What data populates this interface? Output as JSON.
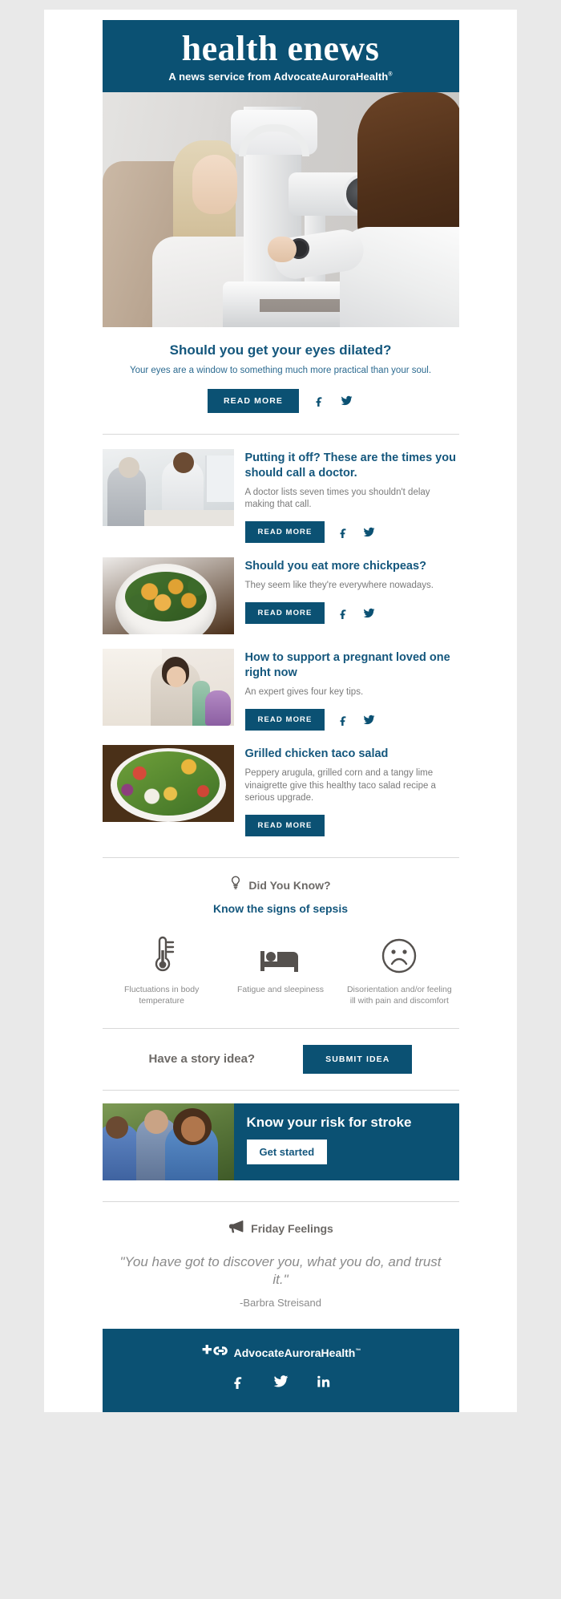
{
  "masthead": {
    "title": "health enews",
    "tagline_prefix": "A news service from ",
    "brand": "AdvocateAuroraHealth",
    "tm": "®"
  },
  "hero": {
    "image_alt": "eye-exam-photo",
    "title": "Should you get your eyes dilated?",
    "subtitle": "Your eyes are a window to something much more practical than your soul.",
    "read_more": "READ MORE",
    "facebook_icon": "facebook-icon",
    "twitter_icon": "twitter-icon"
  },
  "articles": [
    {
      "title": "Putting it off? These are the times you should call a doctor.",
      "desc": "A doctor lists seven times you shouldn't delay making that call.",
      "read_more": "READ MORE",
      "thumb": "doctor-and-patient-photo",
      "has_social": true
    },
    {
      "title": "Should you eat more chickpeas?",
      "desc": "They seem like they're everywhere nowadays.",
      "read_more": "READ MORE",
      "thumb": "chickpea-bowl-photo",
      "has_social": true
    },
    {
      "title": "How to support a pregnant loved one right now",
      "desc": "An expert gives four key tips.",
      "read_more": "READ MORE",
      "thumb": "pregnant-woman-photo",
      "has_social": true
    },
    {
      "title": "Grilled chicken taco salad",
      "desc": "Peppery arugula, grilled corn and a tangy lime vinaigrette give this healthy taco salad recipe a serious upgrade.",
      "read_more": "READ MORE",
      "thumb": "taco-salad-photo",
      "has_social": false
    }
  ],
  "did_you_know": {
    "icon": "lightbulb-icon",
    "label": "Did You Know?",
    "subtitle": "Know the signs of sepsis",
    "signs": [
      {
        "icon": "thermometer-icon",
        "text": "Fluctuations in body temperature"
      },
      {
        "icon": "bed-icon",
        "text": "Fatigue and sleepiness"
      },
      {
        "icon": "frowning-face-icon",
        "text": "Disorientation and/or feeling ill with pain and discomfort"
      }
    ]
  },
  "story_idea": {
    "question": "Have a story idea?",
    "button": "SUBMIT IDEA"
  },
  "stroke_banner": {
    "image_alt": "smiling-people-photo",
    "title": "Know your risk for stroke",
    "button": "Get started"
  },
  "friday_feelings": {
    "icon": "megaphone-icon",
    "label": "Friday Feelings",
    "quote": "\"You have got to discover you, what you do, and trust it.\"",
    "author": "-Barbra Streisand"
  },
  "footer": {
    "logo_icon": "advocate-aurora-logo-icon",
    "brand": "AdvocateAuroraHealth",
    "tm": "™",
    "social": [
      {
        "icon": "facebook-icon",
        "name": "Facebook"
      },
      {
        "icon": "twitter-icon",
        "name": "Twitter"
      },
      {
        "icon": "linkedin-icon",
        "name": "LinkedIn"
      }
    ]
  },
  "colors": {
    "brand_blue": "#0b5173",
    "link_blue": "#14577d",
    "body_gray": "#8b8b8b",
    "page_bg": "#e9e9e9"
  }
}
